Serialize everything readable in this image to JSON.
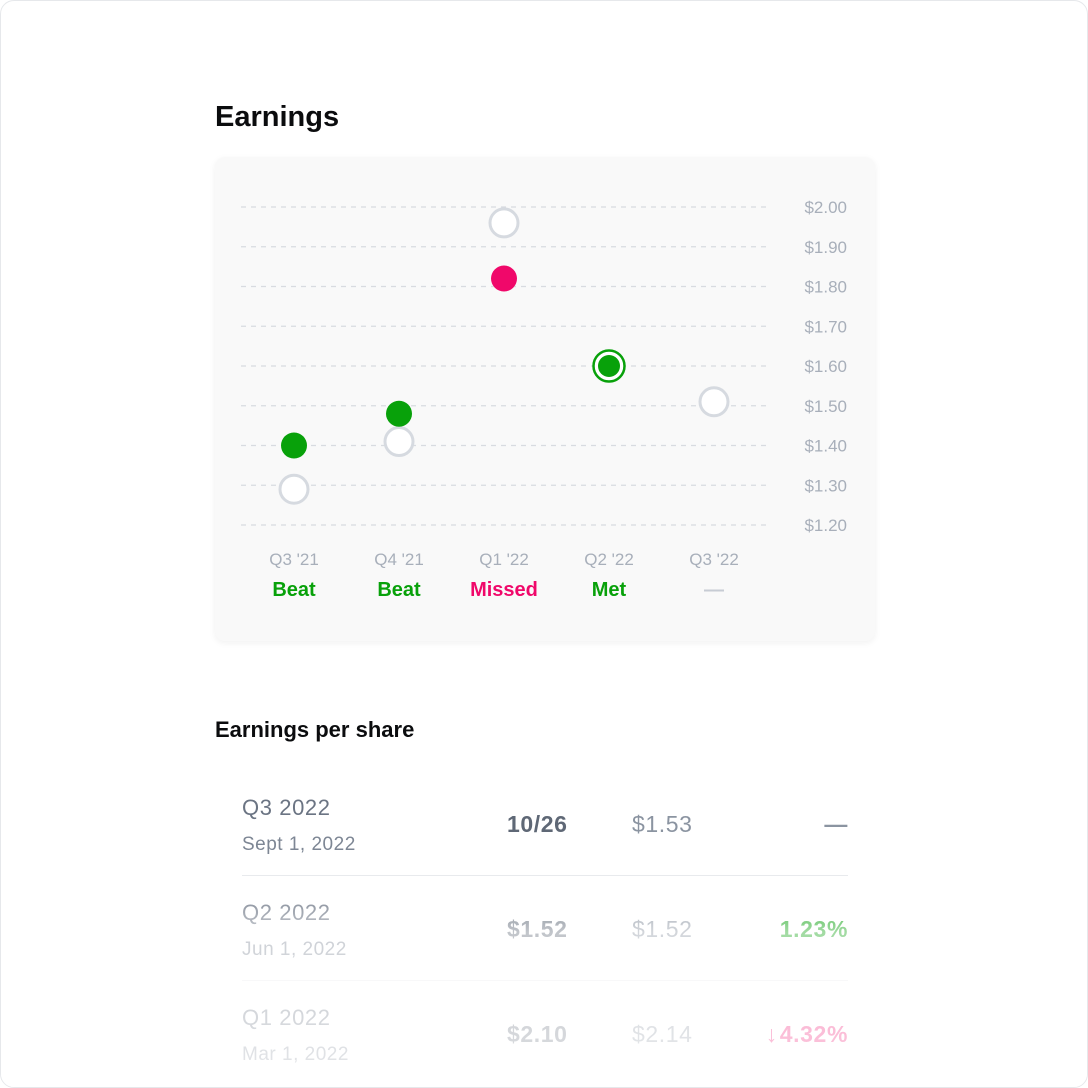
{
  "page": {
    "title": "Earnings"
  },
  "chart_data": {
    "type": "scatter",
    "ylim": [
      1.2,
      2.0
    ],
    "y_ticks": [
      {
        "value": 2.0,
        "label": "$2.00"
      },
      {
        "value": 1.9,
        "label": "$1.90"
      },
      {
        "value": 1.8,
        "label": "$1.80"
      },
      {
        "value": 1.7,
        "label": "$1.70"
      },
      {
        "value": 1.6,
        "label": "$1.60"
      },
      {
        "value": 1.5,
        "label": "$1.50"
      },
      {
        "value": 1.4,
        "label": "$1.40"
      },
      {
        "value": 1.3,
        "label": "$1.30"
      },
      {
        "value": 1.2,
        "label": "$1.20"
      }
    ],
    "categories": [
      "Q3 '21",
      "Q4 '21",
      "Q1 '22",
      "Q2 '22",
      "Q3 '22"
    ],
    "estimate": [
      1.29,
      1.41,
      1.96,
      1.6,
      1.51
    ],
    "actual": [
      1.4,
      1.48,
      1.82,
      1.6,
      null
    ],
    "results": [
      {
        "label": "Beat",
        "status": "beat"
      },
      {
        "label": "Beat",
        "status": "beat"
      },
      {
        "label": "Missed",
        "status": "missed"
      },
      {
        "label": "Met",
        "status": "met"
      },
      {
        "label": "—",
        "status": "none"
      }
    ],
    "grid": true,
    "y_axis_position": "right",
    "colors": {
      "beat": "#08a10a",
      "met": "#08a10a",
      "missed": "#f0086a",
      "none": "#c7ccd4",
      "estimate_stroke": "#d6dae0",
      "grid": "#d8dbe0",
      "tick_text": "#a8afba"
    }
  },
  "eps": {
    "title": "Earnings per share",
    "rows": [
      {
        "quarter": "Q3 2022",
        "date": "Sept 1, 2022",
        "actual": "10/26",
        "estimate": "$1.53",
        "surprise": "—",
        "arrow": "",
        "surprise_color": "#8b94a1"
      },
      {
        "quarter": "Q2 2022",
        "date": "Jun 1, 2022",
        "actual": "$1.52",
        "estimate": "$1.52",
        "surprise": "1.23%",
        "arrow": "",
        "surprise_color": "#0ca10e"
      },
      {
        "quarter": "Q1 2022",
        "date": "Mar 1, 2022",
        "actual": "$2.10",
        "estimate": "$2.14",
        "surprise": "4.32%",
        "arrow": "↓",
        "surprise_color": "#f0086a"
      }
    ]
  }
}
